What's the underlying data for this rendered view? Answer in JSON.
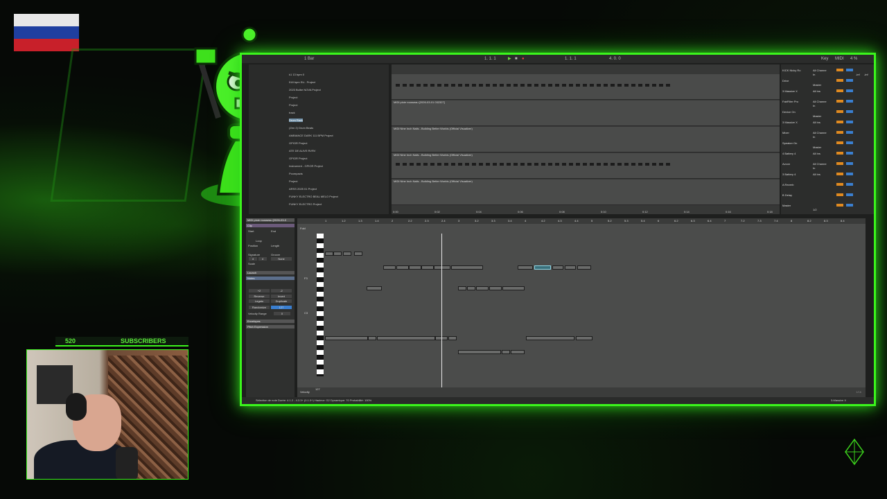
{
  "overlay": {
    "subscriber_count": "520",
    "subscriber_label": "SUBSCRIBERS"
  },
  "toolbar": {
    "bar_value": "1 Bar",
    "position": "1. 1. 1",
    "loop_start": "1. 1. 1",
    "loop_end": "4. 0. 0",
    "key_label": "Key",
    "midi_label": "MIDI",
    "cpu": "4 %"
  },
  "browser": {
    "items": [
      "k1 13 bpm 0",
      "518 bpm SU.. Project",
      "2023 Bulbe NOVA Project",
      "Project",
      "Project",
      "track",
      "Drum Rack",
      "(Zen 2) Drum Beats",
      "AMBIANCE DARK 111 BPM Project",
      "GPIOR Project",
      "ATE DE ALIVE RVRV",
      "GPIOR Project",
      "Instrument - GPIOR Project",
      "Pcompacts",
      "Project",
      "ARSS 2025 01 Project",
      "FUNKY ELECTRO BEAL MELO Project",
      "FUNKY ELECTRO Project"
    ]
  },
  "arrangement": {
    "tracks": [
      {
        "title": ""
      },
      {
        "title": "MIDI pluie rousseau [2026-03-01 032327]"
      },
      {
        "title": "MIDI Nine Inch Nails - Building Better Worlds (Official Visualizer)"
      },
      {
        "title": "MIDI Nine Inch Nails - Building Better Worlds (Official Visualizer)"
      },
      {
        "title": "MIDI Nine Inch Nails - Building Better Worlds (Official Visualizer)"
      }
    ],
    "timeline": [
      "0:00",
      "0:02",
      "0:04",
      "0:06",
      "0:08",
      "0:10",
      "0:12",
      "0:14",
      "0:16",
      "0:18"
    ]
  },
  "mixer": {
    "rows": [
      {
        "name": "KICK Nicky Ro",
        "input": "All Channe",
        "mode": "In"
      },
      {
        "name": "Drive",
        "input": "",
        "mode": "Master"
      },
      {
        "name": "3 Massive X",
        "input": "All Ins",
        "mode": ""
      },
      {
        "name": "FabFilter Pro",
        "input": "All Channe",
        "mode": "In"
      },
      {
        "name": "Device On",
        "input": "",
        "mode": "Master"
      },
      {
        "name": "3 Massive X",
        "input": "All Ins",
        "mode": ""
      },
      {
        "name": "Mixer",
        "input": "All Channe",
        "mode": "In"
      },
      {
        "name": "Speaker On",
        "input": "",
        "mode": "Master"
      },
      {
        "name": "4 Battery 4",
        "input": "All Ins",
        "mode": ""
      },
      {
        "name": "Avcon",
        "input": "All Channe",
        "mode": "In"
      },
      {
        "name": "3 Battery 4",
        "input": "All Ins",
        "mode": ""
      },
      {
        "name": "A Reverb",
        "input": "",
        "mode": ""
      },
      {
        "name": "B Delay",
        "input": "",
        "mode": ""
      },
      {
        "name": "Master",
        "input": "",
        "mode": "1/2"
      }
    ],
    "values": [
      "-inf",
      "-inf"
    ]
  },
  "clip": {
    "name": "MIDI pluie rousseau [2026-03-0",
    "sections": [
      "Clip",
      "Launch",
      "Notes",
      "Envelopes",
      "Pitch Expression"
    ],
    "labels": {
      "start": "Start",
      "end": "End",
      "loop": "Loop",
      "position": "Position",
      "length": "Length",
      "signature": "Signature",
      "groove": "Groove",
      "scale": "Scale",
      "none": "None",
      "reverse": "Reverse",
      "invert": "Invert",
      "legato": "Legato",
      "duplicate": "Duplicate",
      "randomize": "Randomize",
      "velocity_range": "Velocity Range",
      "sig_num": "4",
      "sig_den": "4",
      "double_label": "+2",
      "half_label": "-2",
      "rand_value": "127",
      "vel_value": "0"
    }
  },
  "piano_roll": {
    "ruler": [
      "1",
      "1.2",
      "1.3",
      "1.4",
      "2",
      "2.2",
      "2.3",
      "2.4",
      "3",
      "3.2",
      "3.3",
      "3.4",
      "4",
      "4.2",
      "4.3",
      "4.4",
      "5",
      "5.2",
      "5.3",
      "5.4",
      "6",
      "6.2",
      "6.3",
      "6.4",
      "7",
      "7.2",
      "7.3",
      "7.4",
      "8",
      "8.2",
      "8.3",
      "8.4"
    ],
    "fold_label": "Fold",
    "key_labels": [
      "F3",
      "C3"
    ],
    "velocity_label": "Velocity",
    "velocity_value": "127",
    "page_indicator": "1/16"
  },
  "status_bar": {
    "text": "Sélection de note   Durée: 4.1.2 - 4.3.3+ (0.1.0+)   Hauteur: G2   Dynamique: 70   Probabilité: 100%",
    "track_name": "3-Massive X"
  }
}
